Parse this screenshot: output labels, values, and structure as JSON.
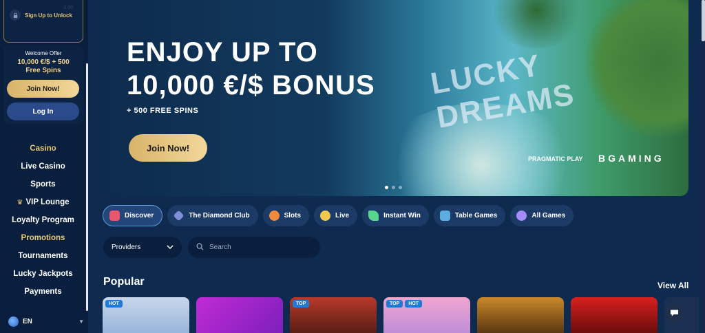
{
  "sidebar": {
    "unlock_label": "Sign Up to Unlock",
    "welcome_offer": {
      "title": "Welcome Offer",
      "line1": "10,000 €/$ + 500",
      "line2": "Free Spins"
    },
    "join_label": "Join Now!",
    "login_label": "Log In",
    "nav": [
      {
        "label": "Casino",
        "style": "gold"
      },
      {
        "label": "Live Casino",
        "style": "white"
      },
      {
        "label": "Sports",
        "style": "white"
      },
      {
        "label": "VIP Lounge",
        "style": "white",
        "icon": "crown-icon"
      },
      {
        "label": "Loyalty Program",
        "style": "white"
      },
      {
        "label": "Promotions",
        "style": "gold"
      },
      {
        "label": "Tournaments",
        "style": "white"
      },
      {
        "label": "Lucky Jackpots",
        "style": "white"
      },
      {
        "label": "Payments",
        "style": "white"
      }
    ],
    "language": "EN"
  },
  "hero": {
    "title_line1": "ENJOY UP TO",
    "title_line2": "10,000 €/$ BONUS",
    "subtitle": "+ 500 FREE SPINS",
    "join_label": "Join Now!",
    "logo_line1": "LUCKY",
    "logo_line2": "DREAMS",
    "partner1": "PRAGMATIC PLAY",
    "partner2": "BGAMING",
    "slide_count": 3,
    "active_slide": 1
  },
  "tabs": [
    {
      "label": "Discover",
      "icon": "discover-icon",
      "color": "#e8566b",
      "active": true
    },
    {
      "label": "The Diamond Club",
      "icon": "diamond-icon",
      "color": "#7f8fd6",
      "active": false
    },
    {
      "label": "Slots",
      "icon": "slots-icon",
      "color": "#f08a3c",
      "active": false
    },
    {
      "label": "Live",
      "icon": "live-icon",
      "color": "#f2c94c",
      "active": false
    },
    {
      "label": "Instant Win",
      "icon": "rocket-icon",
      "color": "#58d68d",
      "active": false
    },
    {
      "label": "Table Games",
      "icon": "cards-icon",
      "color": "#5dade2",
      "active": false
    },
    {
      "label": "All Games",
      "icon": "all-games-icon",
      "color": "#a78bfa",
      "active": false
    }
  ],
  "filters": {
    "providers_label": "Providers",
    "search_placeholder": "Search"
  },
  "popular": {
    "title": "Popular",
    "view_all": "View All",
    "cards": [
      {
        "badges": [
          "HOT"
        ],
        "bg": "linear-gradient(180deg,#c8d7ea,#8fb0d8)"
      },
      {
        "badges": [],
        "bg": "linear-gradient(135deg,#c02bd6,#7a1fb8)"
      },
      {
        "badges": [
          "TOP"
        ],
        "bg": "linear-gradient(180deg,#b83a2a,#4a1a12)"
      },
      {
        "badges": [
          "TOP",
          "HOT"
        ],
        "bg": "linear-gradient(180deg,#f0a6d0,#b88ad8)"
      },
      {
        "badges": [],
        "bg": "linear-gradient(180deg,#c9892a,#4a2a0f)"
      },
      {
        "badges": [],
        "bg": "linear-gradient(180deg,#d8201e,#5a0a0a)"
      }
    ]
  }
}
